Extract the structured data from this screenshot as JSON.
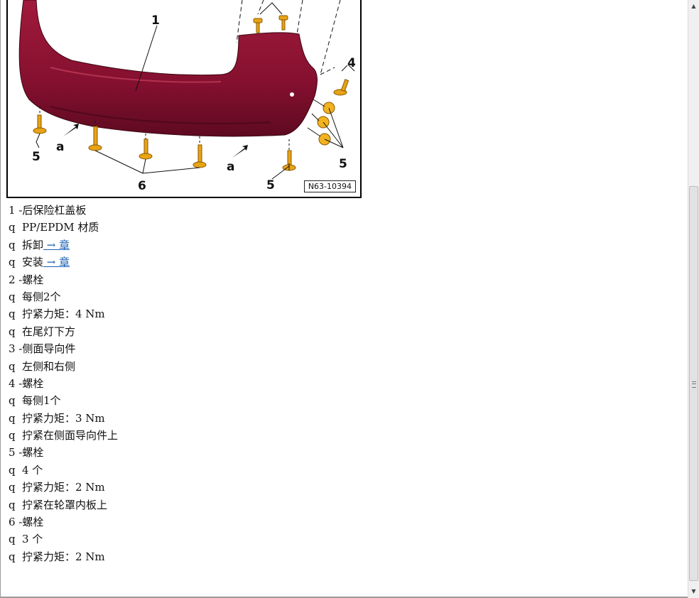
{
  "figure": {
    "ref_code": "N63-10394",
    "callouts": {
      "c1": "1",
      "c4": "4",
      "c5a": "5",
      "c5b": "5",
      "c5c": "5",
      "c6": "6",
      "ca1": "a",
      "ca2": "a"
    }
  },
  "lines": [
    {
      "num": "1 - ",
      "text": "后保险杠盖板"
    },
    {
      "bullet": "q",
      "text": "PP/EPDM 材质"
    },
    {
      "bullet": "q",
      "text": "拆卸",
      "link": " → 章"
    },
    {
      "bullet": "q",
      "text": "安装",
      "link": " → 章"
    },
    {
      "num": "2 - ",
      "text": "螺栓"
    },
    {
      "bullet": "q",
      "text": "每侧2个"
    },
    {
      "bullet": "q",
      "text": "拧紧力矩：4 Nm"
    },
    {
      "bullet": "q",
      "text": "在尾灯下方"
    },
    {
      "num": "3 - ",
      "text": "侧面导向件"
    },
    {
      "bullet": "q",
      "text": "左侧和右侧"
    },
    {
      "num": "4 - ",
      "text": "螺栓"
    },
    {
      "bullet": "q",
      "text": "每侧1个"
    },
    {
      "bullet": "q",
      "text": "拧紧力矩：3 Nm"
    },
    {
      "bullet": "q",
      "text": "拧紧在侧面导向件上"
    },
    {
      "num": "5 - ",
      "text": "螺栓"
    },
    {
      "bullet": "q",
      "text": "4 个"
    },
    {
      "bullet": "q",
      "text": "拧紧力矩：2 Nm"
    },
    {
      "bullet": "q",
      "text": "拧紧在轮罩内板上"
    },
    {
      "num": "6 - ",
      "text": "螺栓"
    },
    {
      "bullet": "q",
      "text": "3 个"
    },
    {
      "bullet": "q",
      "text": "拧紧力矩：2 Nm"
    }
  ],
  "colors": {
    "bumper": "#8a1030",
    "bumper_dark": "#5a0a1e",
    "bolt": "#e8a317",
    "link": "#1a5fb4"
  },
  "scrollbar": {
    "up_icon": "scroll-up-arrow",
    "down_icon": "scroll-down-arrow"
  }
}
